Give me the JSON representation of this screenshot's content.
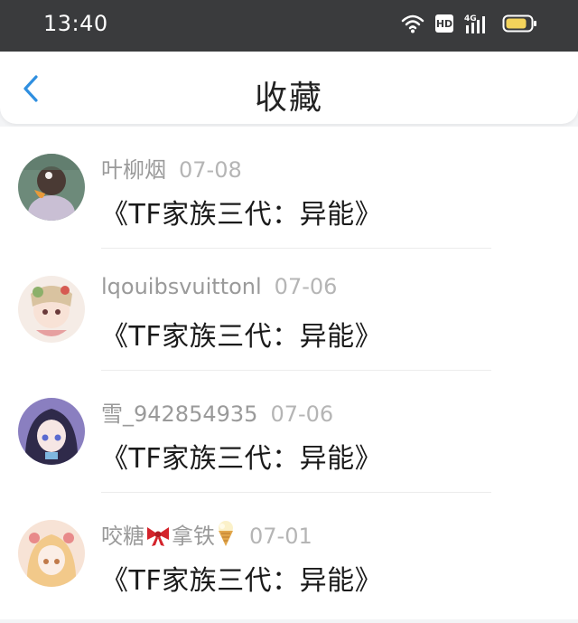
{
  "status_bar": {
    "time": "13:40",
    "hd_label": "HD",
    "network_label": "4G"
  },
  "header": {
    "title": "收藏"
  },
  "items": [
    {
      "user": "叶柳烟",
      "date": "07-08",
      "title": "《TF家族三代：异能》",
      "avatar_color": "#6d8a7a"
    },
    {
      "user": "lqouibsvuittonl",
      "date": "07-06",
      "title": "《TF家族三代：异能》",
      "avatar_color": "#e8b0a8"
    },
    {
      "user": "雪_942854935",
      "date": "07-06",
      "title": "《TF家族三代：异能》",
      "avatar_color": "#6a6fb0"
    },
    {
      "user_prefix": "咬糖",
      "user_middle": "拿铁",
      "date": "07-01",
      "title": "《TF家族三代：异能》",
      "avatar_color": "#f2c9a8",
      "emoji_1": "ribbon-icon",
      "emoji_2": "ice-cream-icon"
    }
  ],
  "colors": {
    "status_bar_bg": "#3a3b3d",
    "accent_back": "#2f8fe0",
    "meta_text": "#9a9a9a",
    "title_text": "#1a1a1a"
  }
}
